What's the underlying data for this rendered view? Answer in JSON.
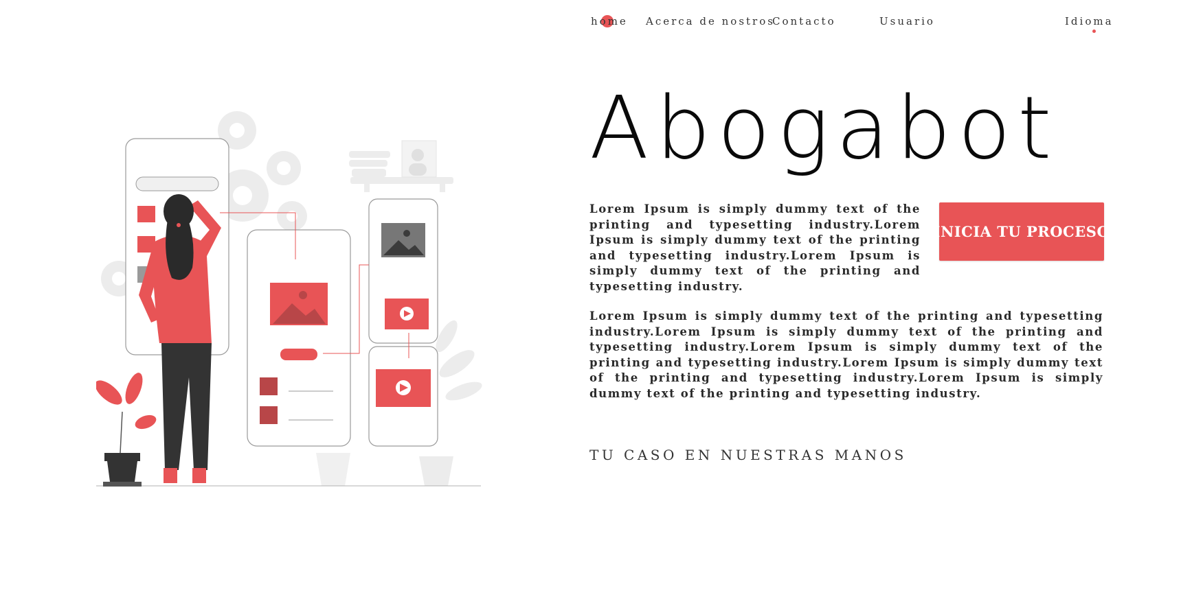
{
  "nav": {
    "home": "home",
    "about": "Acerca de nostros",
    "contact": "Contacto",
    "user": "Usuario",
    "language": "Idioma"
  },
  "hero": {
    "title": "Abogabot",
    "intro": "Lorem Ipsum is simply dummy text of the printing and typesetting industry.Lorem Ipsum is simply dummy text of the printing and typesetting industry.Lorem Ipsum is simply dummy text of the printing and typesetting industry.",
    "cta_label": "INICIA TU PROCESO",
    "body": "Lorem Ipsum is simply dummy text of the printing and typesetting industry.Lorem Ipsum is simply dummy text of the printing and typesetting industry.Lorem Ipsum is simply dummy text of the printing and typesetting industry.Lorem Ipsum is simply dummy text of the printing and typesetting industry.Lorem Ipsum is simply dummy text of the printing and typesetting industry.",
    "tagline": "TU CASO EN NUESTRAS MANOS"
  },
  "colors": {
    "accent": "#e85456",
    "text": "#2a2a2a",
    "title": "#0a0a0a",
    "background": "#ffffff"
  }
}
